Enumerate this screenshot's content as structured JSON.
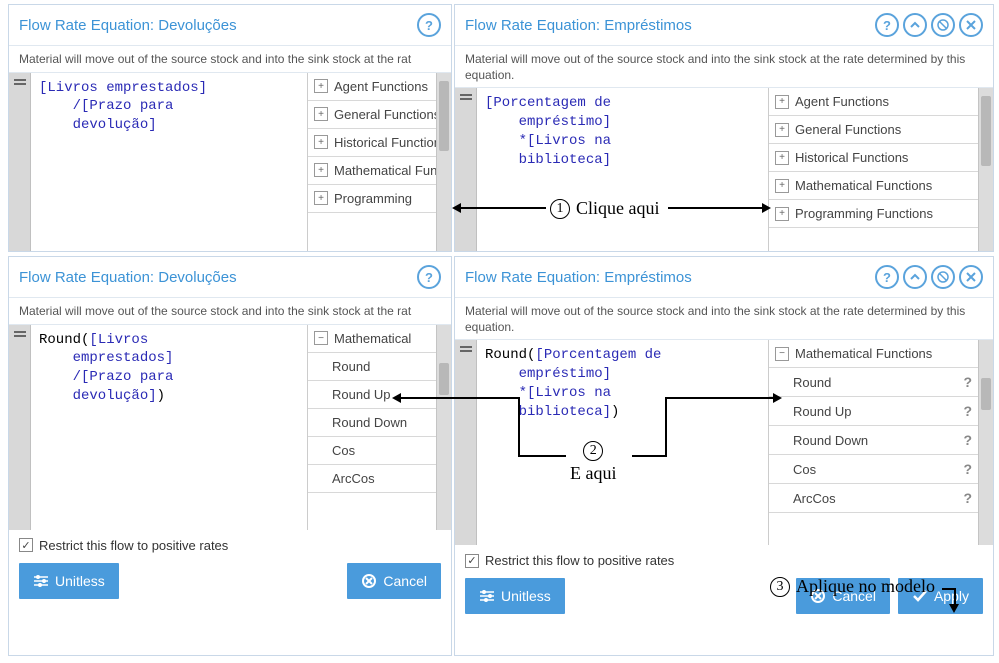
{
  "tl": {
    "title": "Flow Rate Equation: Devoluções",
    "desc": "Material will move out of the source stock and into the sink stock at the rat",
    "code": "[Livros emprestados]\n    /[Prazo para\n    devolução]",
    "fns": [
      "Agent Functions",
      "General Functions",
      "Historical Functions",
      "Mathematical Functions",
      "Programming"
    ]
  },
  "tr": {
    "title": "Flow Rate Equation: Empréstimos",
    "desc": "Material will move out of the source stock and into the sink stock at the rate determined by this equation.",
    "code": "[Porcentagem de\n    empréstimo]\n    *[Livros na\n    biblioteca]",
    "fns": [
      "Agent Functions",
      "General Functions",
      "Historical Functions",
      "Mathematical Functions",
      "Programming Functions"
    ]
  },
  "bl": {
    "title": "Flow Rate Equation: Devoluções",
    "desc": "Material will move out of the source stock and into the sink stock at the rat",
    "code": "Round([Livros\n    emprestados]\n    /[Prazo para\n    devolução])",
    "fn_header": "Mathematical",
    "subs": [
      "Round",
      "Round Up",
      "Round Down",
      "Cos",
      "ArcCos"
    ],
    "restrict": "Restrict this flow to positive rates",
    "unitless": "Unitless",
    "cancel": "Cancel"
  },
  "br": {
    "title": "Flow Rate Equation: Empréstimos",
    "desc": "Material will move out of the source stock and into the sink stock at the rate determined by this equation.",
    "code": "Round([Porcentagem de\n    empréstimo]\n    *[Livros na\n    biblioteca])",
    "fn_header": "Mathematical Functions",
    "subs": [
      "Round",
      "Round Up",
      "Round Down",
      "Cos",
      "ArcCos"
    ],
    "restrict": "Restrict this flow to positive rates",
    "unitless": "Unitless",
    "cancel": "Cancel",
    "apply": "Apply"
  },
  "ann": {
    "a1": "Clique aqui",
    "a2": "E aqui",
    "a3": "Aplique no modelo"
  }
}
